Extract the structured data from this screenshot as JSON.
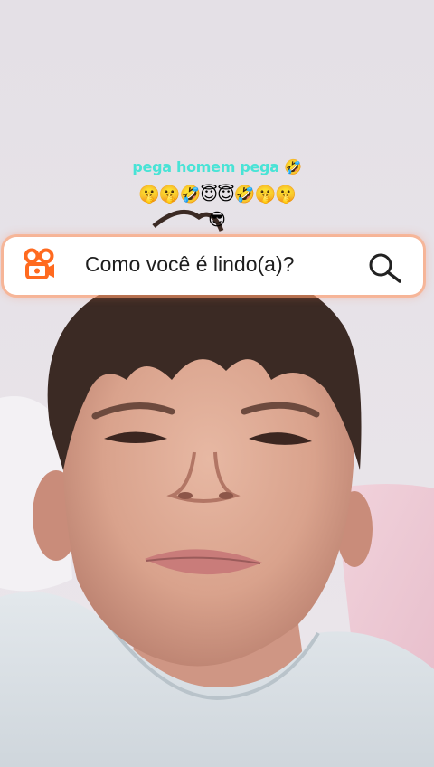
{
  "caption": {
    "line1": "pega homem pega 🤣",
    "line2": "🤫🤫🤣😇😇🤣🤫🤫",
    "line3": "😎"
  },
  "search": {
    "query": "Como você é lindo(a)?"
  },
  "icons": {
    "logo": "kwai-logo-icon",
    "search": "search-icon"
  },
  "colors": {
    "caption_text": "#49e3d6",
    "logo_accent": "#ff6a1f",
    "pill_glow": "#ff9a6b"
  }
}
